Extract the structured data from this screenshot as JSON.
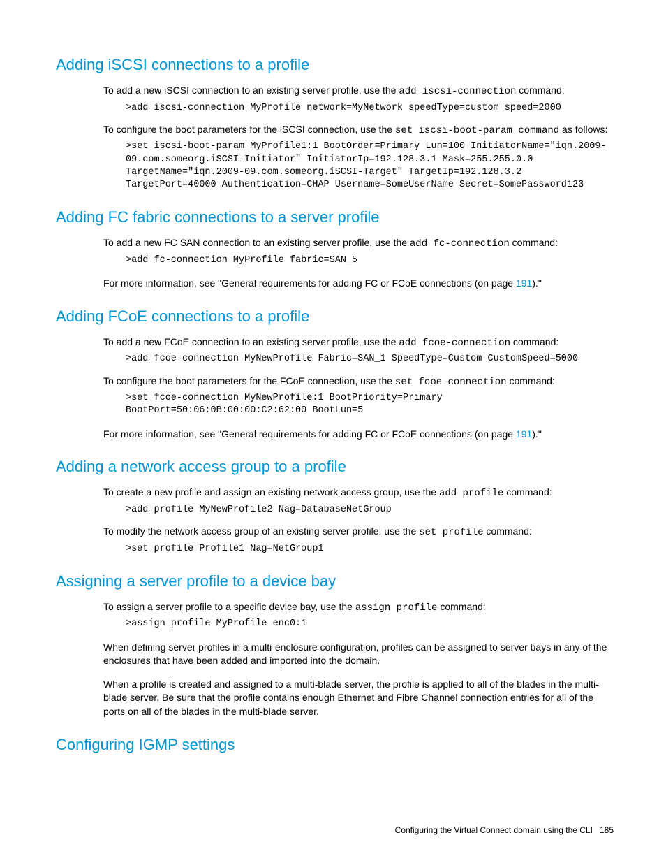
{
  "sections": {
    "iscsi": {
      "heading": "Adding iSCSI connections to a profile",
      "p1_pre": "To add a new iSCSI connection to an existing server profile, use the ",
      "p1_code": "add iscsi-connection",
      "p1_post": " command:",
      "code1": ">add iscsi-connection MyProfile network=MyNetwork speedType=custom speed=2000",
      "p2_pre": "To configure the boot parameters for the iSCSI connection, use the ",
      "p2_code": "set iscsi-boot-param command",
      "p2_post": " as follows:",
      "code2": ">set iscsi-boot-param MyProfile1:1 BootOrder=Primary Lun=100 InitiatorName=\"iqn.2009-09.com.someorg.iSCSI-Initiator\" InitiatorIp=192.128.3.1 Mask=255.255.0.0 TargetName=\"iqn.2009-09.com.someorg.iSCSI-Target\" TargetIp=192.128.3.2 TargetPort=40000 Authentication=CHAP Username=SomeUserName Secret=SomePassword123"
    },
    "fc": {
      "heading": "Adding FC fabric connections to a server profile",
      "p1_pre": "To add a new FC SAN connection to an existing server profile, use the ",
      "p1_code": "add fc-connection",
      "p1_post": " command:",
      "code1": ">add fc-connection MyProfile fabric=SAN_5",
      "p2_pre": "For more information, see \"General requirements for adding FC or FCoE connections (on page ",
      "p2_link": "191",
      "p2_post": ").\""
    },
    "fcoe": {
      "heading": "Adding FCoE connections to a profile",
      "p1_pre": "To add a new FCoE connection to an existing server profile, use the ",
      "p1_code": "add fcoe-connection",
      "p1_post": " command:",
      "code1": ">add fcoe-connection MyNewProfile Fabric=SAN_1 SpeedType=Custom CustomSpeed=5000",
      "p2_pre": "To configure the boot parameters for the FCoE connection, use the ",
      "p2_code": "set fcoe-connection",
      "p2_post": " command:",
      "code2": ">set fcoe-connection MyNewProfile:1 BootPriority=Primary BootPort=50:06:0B:00:00:C2:62:00 BootLun=5",
      "p3_pre": "For more information, see \"General requirements for adding FC or FCoE connections (on page ",
      "p3_link": "191",
      "p3_post": ").\""
    },
    "nag": {
      "heading": "Adding a network access group to a profile",
      "p1_pre": "To create a new profile and assign an existing network access group, use the ",
      "p1_code": "add profile",
      "p1_post": " command:",
      "code1": ">add profile MyNewProfile2 Nag=DatabaseNetGroup",
      "p2_pre": "To modify the network access group of an existing server profile, use the ",
      "p2_code": "set profile",
      "p2_post": " command:",
      "code2": ">set profile Profile1 Nag=NetGroup1"
    },
    "assign": {
      "heading": "Assigning a server profile to a device bay",
      "p1_pre": "To assign a server profile to a specific device bay, use the ",
      "p1_code": "assign profile",
      "p1_post": " command:",
      "code1": ">assign profile MyProfile enc0:1",
      "p2": "When defining server profiles in a multi-enclosure configuration, profiles can be assigned to server bays in any of the enclosures that have been added and imported into the domain.",
      "p3": "When a profile is created and assigned to a multi-blade server, the profile is applied to all of the blades in the multi-blade server. Be sure that the profile contains enough Ethernet and Fibre Channel connection entries for all of the ports on all of the blades in the multi-blade server."
    },
    "igmp": {
      "heading": "Configuring IGMP settings"
    }
  },
  "footer": {
    "text": "Configuring the Virtual Connect domain using the CLI",
    "page": "185"
  }
}
